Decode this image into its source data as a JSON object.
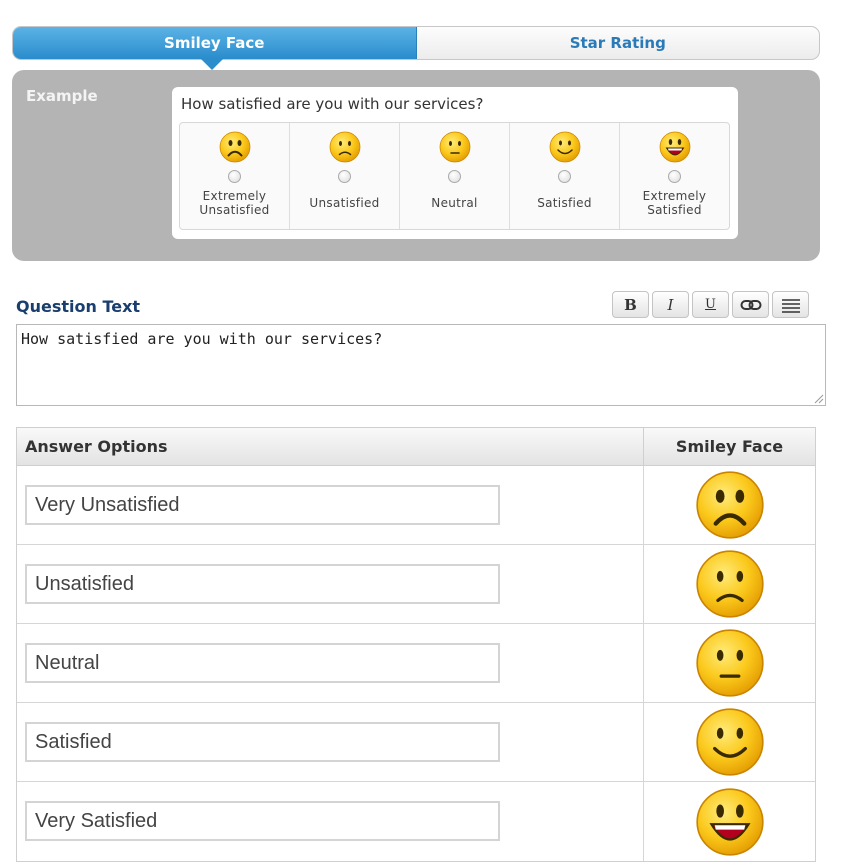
{
  "tabs": [
    {
      "label": "Smiley Face",
      "active": true
    },
    {
      "label": "Star Rating",
      "active": false
    }
  ],
  "example": {
    "label": "Example",
    "question": "How satisfied are you with our services?",
    "options": [
      {
        "label": "Extremely\nUnsatisfied",
        "icon": "very-unsatisfied-face-icon"
      },
      {
        "label": "Unsatisfied",
        "icon": "unsatisfied-face-icon"
      },
      {
        "label": "Neutral",
        "icon": "neutral-face-icon"
      },
      {
        "label": "Satisfied",
        "icon": "satisfied-face-icon"
      },
      {
        "label": "Extremely\nSatisfied",
        "icon": "very-satisfied-face-icon"
      }
    ]
  },
  "question_text": {
    "label": "Question Text",
    "value": "How satisfied are you with our services?",
    "toolbar": [
      "B",
      "I",
      "U",
      "link-icon",
      "align-icon"
    ]
  },
  "answers": {
    "header_options": "Answer Options",
    "header_face": "Smiley Face",
    "rows": [
      {
        "value": "Very Unsatisfied",
        "icon": "very-unsatisfied-face-icon"
      },
      {
        "value": "Unsatisfied",
        "icon": "unsatisfied-face-icon"
      },
      {
        "value": "Neutral",
        "icon": "neutral-face-icon"
      },
      {
        "value": "Satisfied",
        "icon": "satisfied-face-icon"
      },
      {
        "value": "Very Satisfied",
        "icon": "very-satisfied-face-icon"
      }
    ]
  },
  "colors": {
    "accent": "#2a8ccc",
    "panel": "#b4b4b4",
    "face": "#f9c21a",
    "heading": "#1a3e6e"
  }
}
